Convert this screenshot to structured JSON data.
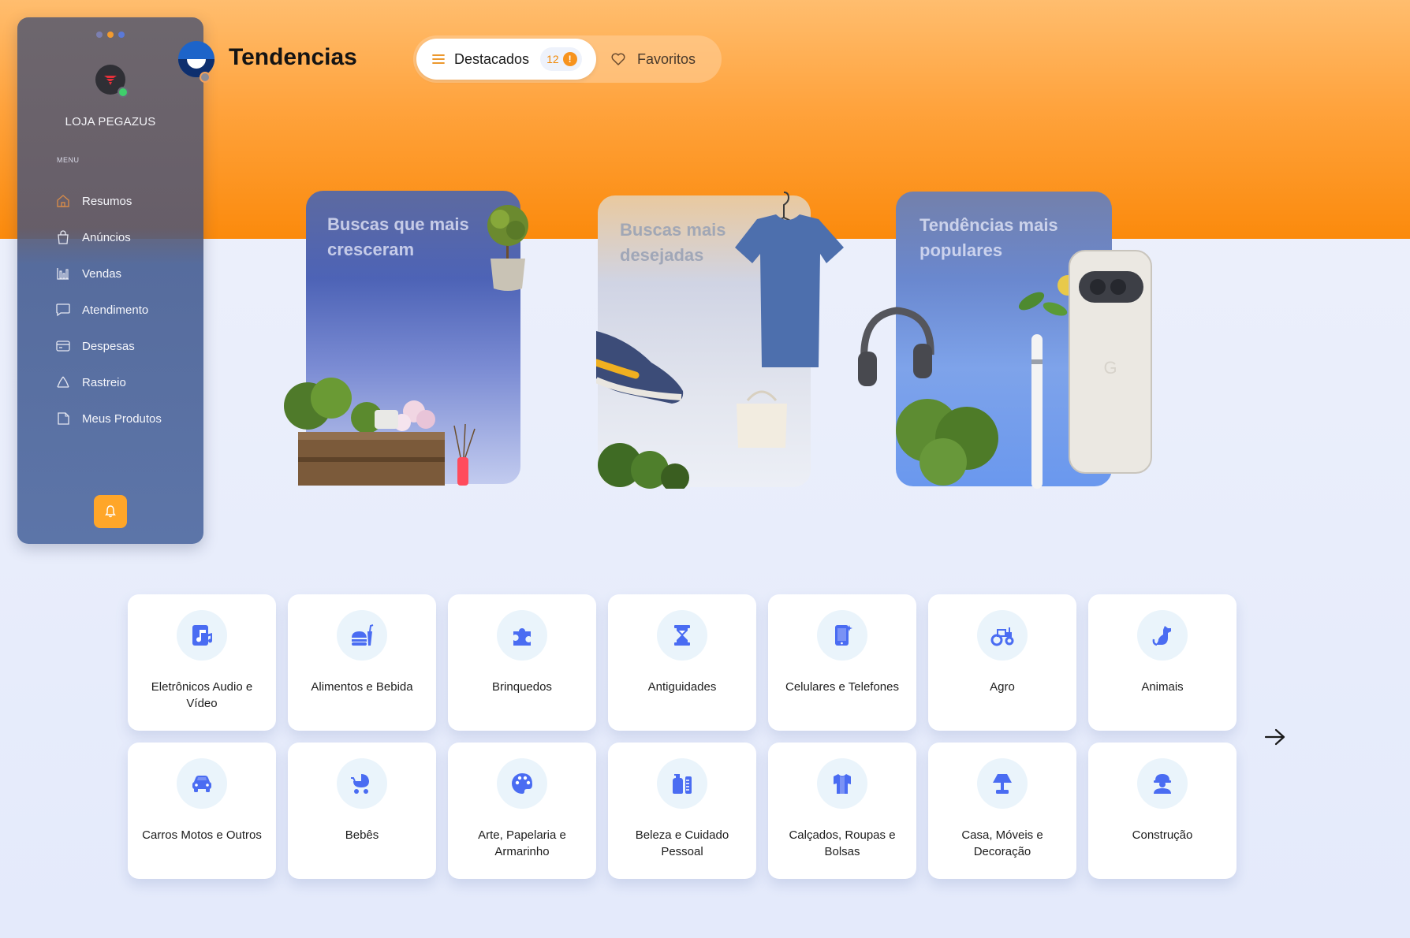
{
  "sidebar": {
    "store_name": "LOJA PEGAZUS",
    "menu_label": "MENU",
    "items": [
      {
        "label": "Resumos",
        "icon": "home-icon"
      },
      {
        "label": "Anúncios",
        "icon": "shopping-bag-icon"
      },
      {
        "label": "Vendas",
        "icon": "bar-chart-icon"
      },
      {
        "label": "Atendimento",
        "icon": "chat-bubble-icon"
      },
      {
        "label": "Despesas",
        "icon": "credit-card-icon"
      },
      {
        "label": "Rastreio",
        "icon": "recycle-icon"
      },
      {
        "label": "Meus Produtos",
        "icon": "tag-icon"
      }
    ],
    "notification_icon": "bell-icon"
  },
  "header": {
    "title": "Tendencias",
    "tabs": {
      "featured_label": "Destacados",
      "featured_count": "12",
      "featured_alert": "!",
      "favorites_label": "Favoritos"
    }
  },
  "trends": [
    {
      "title_line1": "Buscas que mais",
      "title_line2": "cresceram"
    },
    {
      "title_line1": "Buscas mais",
      "title_line2": "desejadas"
    },
    {
      "title_line1": "Tendências mais",
      "title_line2": "populares"
    }
  ],
  "categories": [
    {
      "label": "Eletrônicos Audio e Vídeo",
      "icon": "music-file-icon"
    },
    {
      "label": "Alimentos e Bebida",
      "icon": "burger-drink-icon"
    },
    {
      "label": "Brinquedos",
      "icon": "puzzle-icon"
    },
    {
      "label": "Antiguidades",
      "icon": "hourglass-icon"
    },
    {
      "label": "Celulares e Telefones",
      "icon": "mobile-phone-icon"
    },
    {
      "label": "Agro",
      "icon": "tractor-icon"
    },
    {
      "label": "Animais",
      "icon": "dog-icon"
    },
    {
      "label": "Carros Motos e Outros",
      "icon": "car-icon"
    },
    {
      "label": "Bebês",
      "icon": "baby-carriage-icon"
    },
    {
      "label": "Arte, Papelaria e Armarinho",
      "icon": "palette-icon"
    },
    {
      "label": "Beleza e Cuidado Pessoal",
      "icon": "pump-bottle-icon"
    },
    {
      "label": "Calçados, Roupas e Bolsas",
      "icon": "shirt-icon"
    },
    {
      "label": "Casa, Móveis e Decoração",
      "icon": "lamp-icon"
    },
    {
      "label": "Construção",
      "icon": "worker-helmet-icon"
    }
  ],
  "pagination": {
    "next_icon": "arrow-right-icon"
  },
  "colors": {
    "accent_orange": "#FB8A0C",
    "sidebar_blue": "#526CA2",
    "icon_blue": "#4A6CF2",
    "tile_icon_bg": "#EAF4FB"
  }
}
